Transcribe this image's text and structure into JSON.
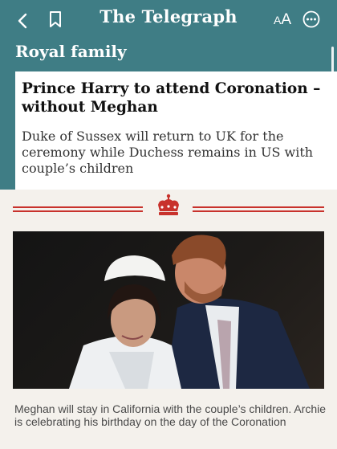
{
  "topbar": {
    "masthead": "The Telegraph",
    "text_size_small": "A",
    "text_size_large": "A"
  },
  "section": {
    "label": "Royal family"
  },
  "article": {
    "headline": "Prince Harry to attend Coronation – without Meghan",
    "standfirst": "Duke of Sussex will return to UK for the ceremony while Duchess remains in US with couple’s children",
    "image_caption": "Meghan will stay in California with the couple’s children. Archie is celebrating his birthday on the day of the Coronation"
  },
  "icons": {
    "back": "back-chevron-icon",
    "bookmark": "bookmark-icon",
    "text_size": "text-size-icon",
    "more": "more-options-icon",
    "divider": "crown-icon"
  },
  "colors": {
    "header_teal": "#3f7d85",
    "accent_red": "#c8322c",
    "page_background": "#f4f1ec"
  }
}
